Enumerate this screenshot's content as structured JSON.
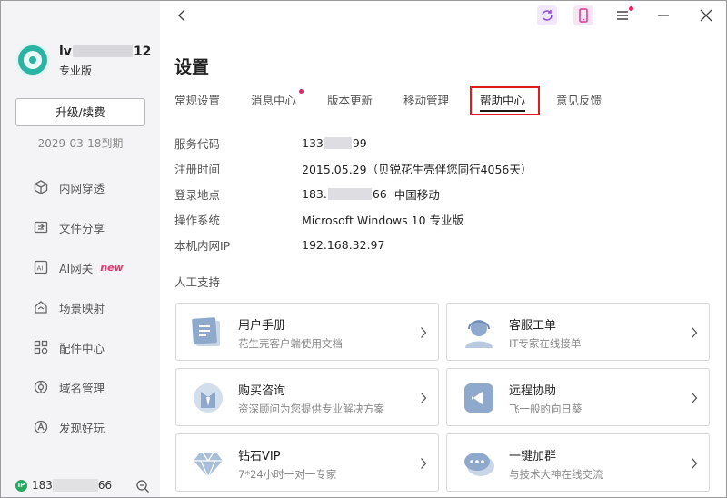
{
  "user": {
    "name_prefix": "lv",
    "name_suffix": "12",
    "level": "专业版"
  },
  "sidebar": {
    "upgrade_label": "升级/续费",
    "expire_text": "2029-03-18到期",
    "items": [
      {
        "label": "内网穿透",
        "icon": "cube-icon"
      },
      {
        "label": "文件分享",
        "icon": "file-share-icon"
      },
      {
        "label": "AI网关",
        "icon": "ai-icon",
        "badge": "new"
      },
      {
        "label": "场景映射",
        "icon": "scene-icon"
      },
      {
        "label": "配件中心",
        "icon": "grid-icon"
      },
      {
        "label": "域名管理",
        "icon": "domain-icon"
      },
      {
        "label": "发现好玩",
        "icon": "discover-icon"
      }
    ],
    "footer": {
      "ip_badge": "IP",
      "ip_prefix": "183",
      "ip_suffix": "66"
    }
  },
  "page": {
    "title": "设置",
    "tabs": [
      {
        "label": "常规设置"
      },
      {
        "label": "消息中心",
        "dot": true
      },
      {
        "label": "版本更新"
      },
      {
        "label": "移动管理"
      },
      {
        "label": "帮助中心",
        "active": true
      },
      {
        "label": "意见反馈"
      }
    ],
    "info": [
      {
        "label": "服务代码",
        "v1": "133",
        "v2": "99"
      },
      {
        "label": "注册时间",
        "value": "2015.05.29（贝锐花生壳伴您同行4056天）"
      },
      {
        "label": "登录地点",
        "v1": "183.",
        "v2": "66",
        "v3": "中国移动"
      },
      {
        "label": "操作系统",
        "value": "Microsoft Windows 10 专业版"
      },
      {
        "label": "本机内网IP",
        "value": "192.168.32.97"
      }
    ],
    "section_title": "人工支持",
    "cards": [
      {
        "title": "用户手册",
        "desc": "花生壳客户端使用文档",
        "icon": "manual-icon"
      },
      {
        "title": "客服工单",
        "desc": "IT专家在线接单",
        "icon": "support-agent-icon"
      },
      {
        "title": "购买咨询",
        "desc": "资深顾问为您提供专业解决方案",
        "icon": "consultant-icon"
      },
      {
        "title": "远程协助",
        "desc": "飞一般的向日葵",
        "icon": "remote-assist-icon"
      },
      {
        "title": "钻石VIP",
        "desc": "7*24小时一对一专家",
        "icon": "diamond-icon"
      },
      {
        "title": "一键加群",
        "desc": "与技术大神在线交流",
        "icon": "chat-group-icon"
      }
    ]
  },
  "colors": {
    "accent": "#e01b1b",
    "dot": "#e8245e",
    "brand": "#2bb3a4",
    "card_icon": "#8fa9cc"
  }
}
